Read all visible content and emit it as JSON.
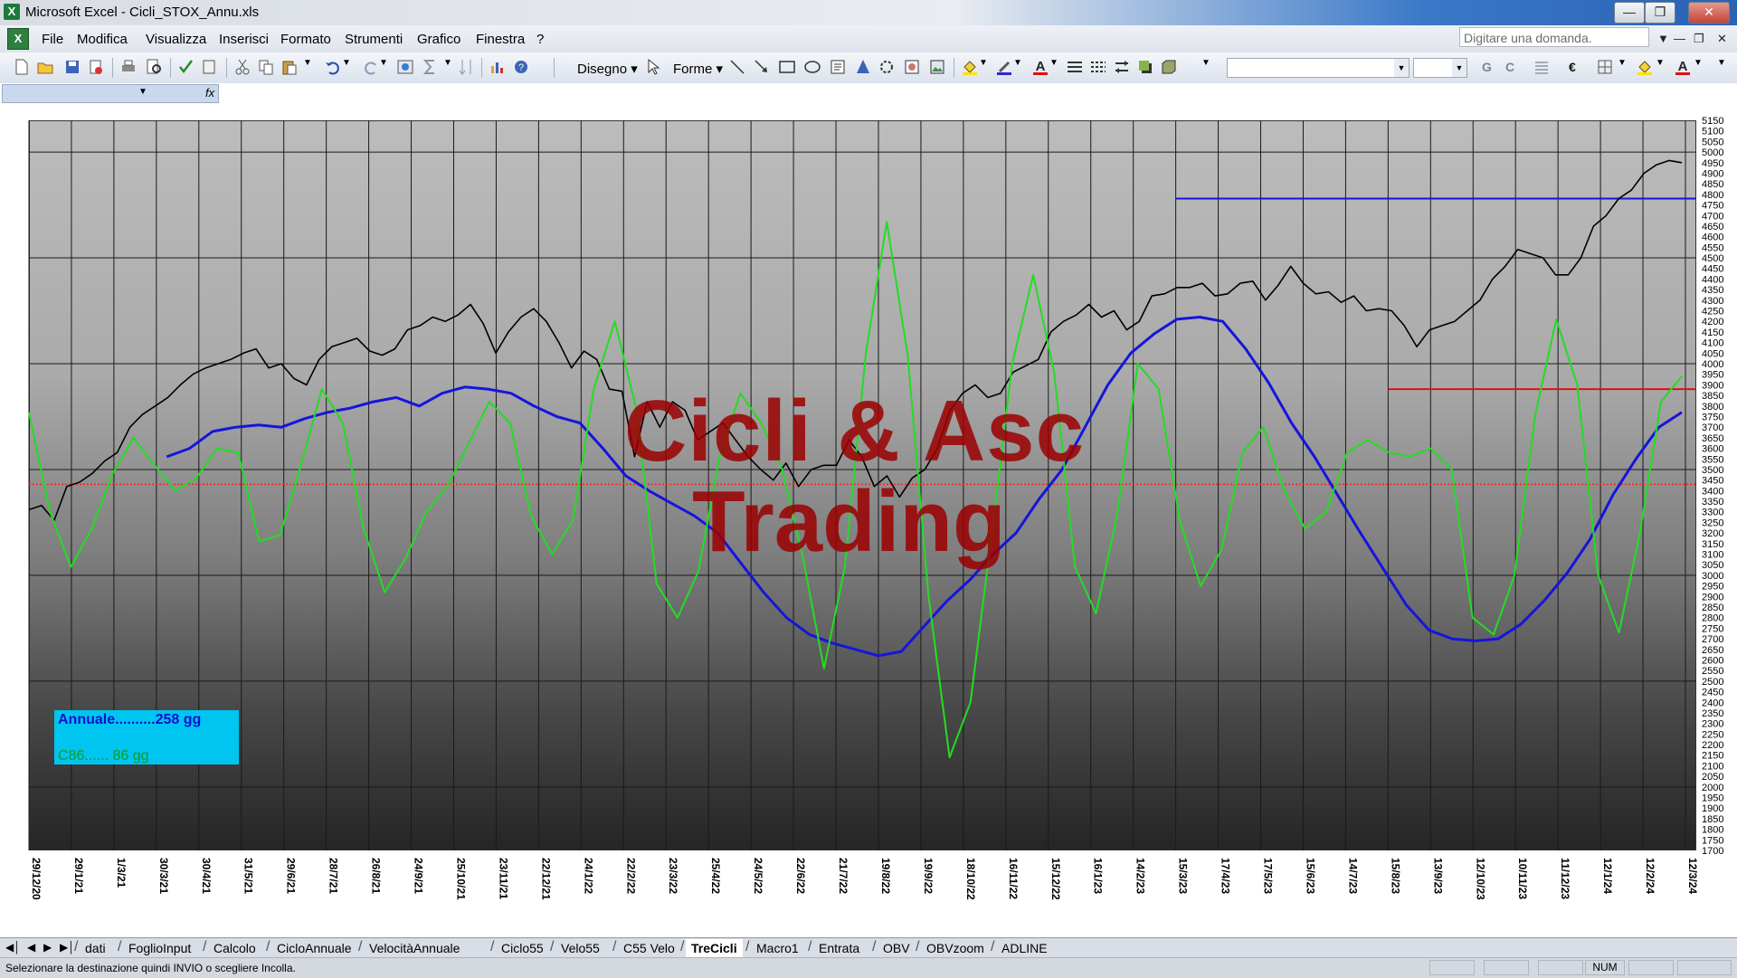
{
  "window": {
    "app_title": "Microsoft Excel - Cicli_STOX_Annu.xls"
  },
  "menu": [
    "File",
    "Modifica",
    "Visualizza",
    "Inserisci",
    "Formato",
    "Strumenti",
    "Grafico",
    "Finestra",
    "?"
  ],
  "help_search": {
    "placeholder": "Digitare una domanda."
  },
  "toolbar": {
    "drawing_label": "Disegno",
    "shapes_label": "Forme",
    "bold_label": "G",
    "italic_label": "C",
    "euro_label": "€"
  },
  "chart_data": {
    "type": "line",
    "title": "",
    "watermark": [
      "Cicli & Asc",
      "Trading"
    ],
    "y_ticks": [
      5150,
      5100,
      5050,
      5000,
      4950,
      4900,
      4850,
      4800,
      4750,
      4700,
      4650,
      4600,
      4550,
      4500,
      4450,
      4400,
      4350,
      4300,
      4250,
      4200,
      4150,
      4100,
      4050,
      4000,
      3950,
      3900,
      3850,
      3800,
      3750,
      3700,
      3650,
      3600,
      3550,
      3500,
      3450,
      3400,
      3350,
      3300,
      3250,
      3200,
      3150,
      3100,
      3050,
      3000,
      2950,
      2900,
      2850,
      2800,
      2750,
      2700,
      2650,
      2600,
      2550,
      2500,
      2450,
      2400,
      2350,
      2300,
      2250,
      2200,
      2150,
      2100,
      2050,
      2000,
      1950,
      1900,
      1850,
      1800,
      1750,
      1700
    ],
    "ylim": [
      1700,
      5150
    ],
    "x_ticks": [
      "29/12/20",
      "29/1/21",
      "1/3/21",
      "30/3/21",
      "30/4/21",
      "31/5/21",
      "29/6/21",
      "28/7/21",
      "26/8/21",
      "24/9/21",
      "25/10/21",
      "23/11/21",
      "22/12/21",
      "24/1/22",
      "22/2/22",
      "23/3/22",
      "25/4/22",
      "24/5/22",
      "22/6/22",
      "21/7/22",
      "19/8/22",
      "19/9/22",
      "18/10/22",
      "16/11/22",
      "15/12/22",
      "16/1/23",
      "14/2/23",
      "15/3/23",
      "17/4/23",
      "17/5/23",
      "15/6/23",
      "14/7/23",
      "15/8/23",
      "13/9/23",
      "12/10/23",
      "10/11/23",
      "11/12/23",
      "12/1/24",
      "12/2/24",
      "12/3/24"
    ],
    "grid": "vertical at each x tick, horizontal every 500 points",
    "series": [
      {
        "name": "",
        "color": "#000000",
        "values": [
          3310,
          3330,
          3260,
          3420,
          3440,
          3480,
          3540,
          3580,
          3700,
          3760,
          3800,
          3840,
          3900,
          3950,
          3980,
          4000,
          4020,
          4050,
          4070,
          3980,
          4000,
          3930,
          3900,
          4020,
          4080,
          4100,
          4120,
          4060,
          4040,
          4070,
          4160,
          4180,
          4220,
          4200,
          4230,
          4280,
          4190,
          4050,
          4150,
          4220,
          4260,
          4200,
          4100,
          3980,
          4060,
          4020,
          3880,
          3870,
          3560,
          3820,
          3700,
          3820,
          3780,
          3640,
          3680,
          3720,
          3640,
          3560,
          3500,
          3450,
          3530,
          3420,
          3500,
          3520,
          3520,
          3640,
          3560,
          3420,
          3470,
          3370,
          3460,
          3500,
          3600,
          3780,
          3860,
          3900,
          3840,
          3860,
          3960,
          3990,
          4020,
          4150,
          4200,
          4230,
          4280,
          4220,
          4250,
          4160,
          4200,
          4320,
          4330,
          4360,
          4360,
          4380,
          4320,
          4330,
          4380,
          4390,
          4300,
          4370,
          4460,
          4380,
          4330,
          4340,
          4290,
          4320,
          4250,
          4260,
          4250,
          4180,
          4080,
          4160,
          4180,
          4200,
          4250,
          4300,
          4400,
          4460,
          4540,
          4520,
          4500,
          4420,
          4420,
          4500,
          4650,
          4700,
          4780,
          4820,
          4900,
          4940,
          4960,
          4950
        ]
      },
      {
        "name": "Annuale",
        "color": "#1515dc",
        "values": [
          null,
          null,
          null,
          null,
          null,
          null,
          3560,
          3600,
          3680,
          3700,
          3710,
          3700,
          3740,
          3770,
          3790,
          3820,
          3840,
          3800,
          3860,
          3890,
          3880,
          3860,
          3800,
          3750,
          3720,
          3600,
          3470,
          3400,
          3340,
          3280,
          3200,
          3060,
          2920,
          2800,
          2720,
          2680,
          2650,
          2620,
          2640,
          2760,
          2880,
          2980,
          3100,
          3200,
          3360,
          3500,
          3700,
          3900,
          4050,
          4140,
          4210,
          4220,
          4200,
          4070,
          3910,
          3720,
          3560,
          3380,
          3200,
          3030,
          2860,
          2740,
          2700,
          2690,
          2700,
          2770,
          2880,
          3010,
          3170,
          3380,
          3550,
          3700,
          3770
        ]
      },
      {
        "name": "C86",
        "color": "#22dd22",
        "values": [
          3770,
          3300,
          3040,
          3220,
          3480,
          3650,
          3520,
          3400,
          3460,
          3600,
          3580,
          3160,
          3190,
          3520,
          3880,
          3720,
          3220,
          2920,
          3080,
          3300,
          3420,
          3620,
          3820,
          3720,
          3280,
          3100,
          3260,
          3880,
          4200,
          3800,
          2960,
          2800,
          3020,
          3560,
          3860,
          3720,
          3500,
          3080,
          2560,
          3040,
          4050,
          4670,
          4040,
          2900,
          2140,
          2400,
          3180,
          4000,
          4420,
          3960,
          3040,
          2820,
          3280,
          4000,
          3880,
          3260,
          2950,
          3120,
          3580,
          3700,
          3400,
          3220,
          3300,
          3580,
          3640,
          3580,
          3560,
          3600,
          3500,
          2800,
          2720,
          3000,
          3760,
          4210,
          3900,
          3000,
          2730,
          3200,
          3820,
          3940
        ]
      }
    ],
    "reference_lines": [
      {
        "value": 4780,
        "color": "#1515dc",
        "from": "15/3/23",
        "to": "12/3/24"
      },
      {
        "value": 3880,
        "color": "#dd1010",
        "from": "15/8/23",
        "to": "12/3/24"
      },
      {
        "value": 3430,
        "color": "#ff2020",
        "style": "dotted",
        "from": "29/12/20",
        "to": "12/3/24"
      }
    ]
  },
  "legend": {
    "line1": "Annuale..........258 gg",
    "line2": "C86......  86 gg"
  },
  "sheet_tabs": [
    "dati",
    "FoglioInput",
    "Calcolo",
    "CicloAnnuale",
    "VelocitàAnnuale",
    "Ciclo55",
    "Velo55",
    "C55 Velo",
    "TreCicli",
    "Macro1",
    "Entrata",
    "OBV",
    "OBVzoom",
    "ADLINE"
  ],
  "active_tab": "TreCicli",
  "status": {
    "message": "Selezionare la destinazione quindi INVIO o scegliere Incolla.",
    "num": "NUM"
  }
}
